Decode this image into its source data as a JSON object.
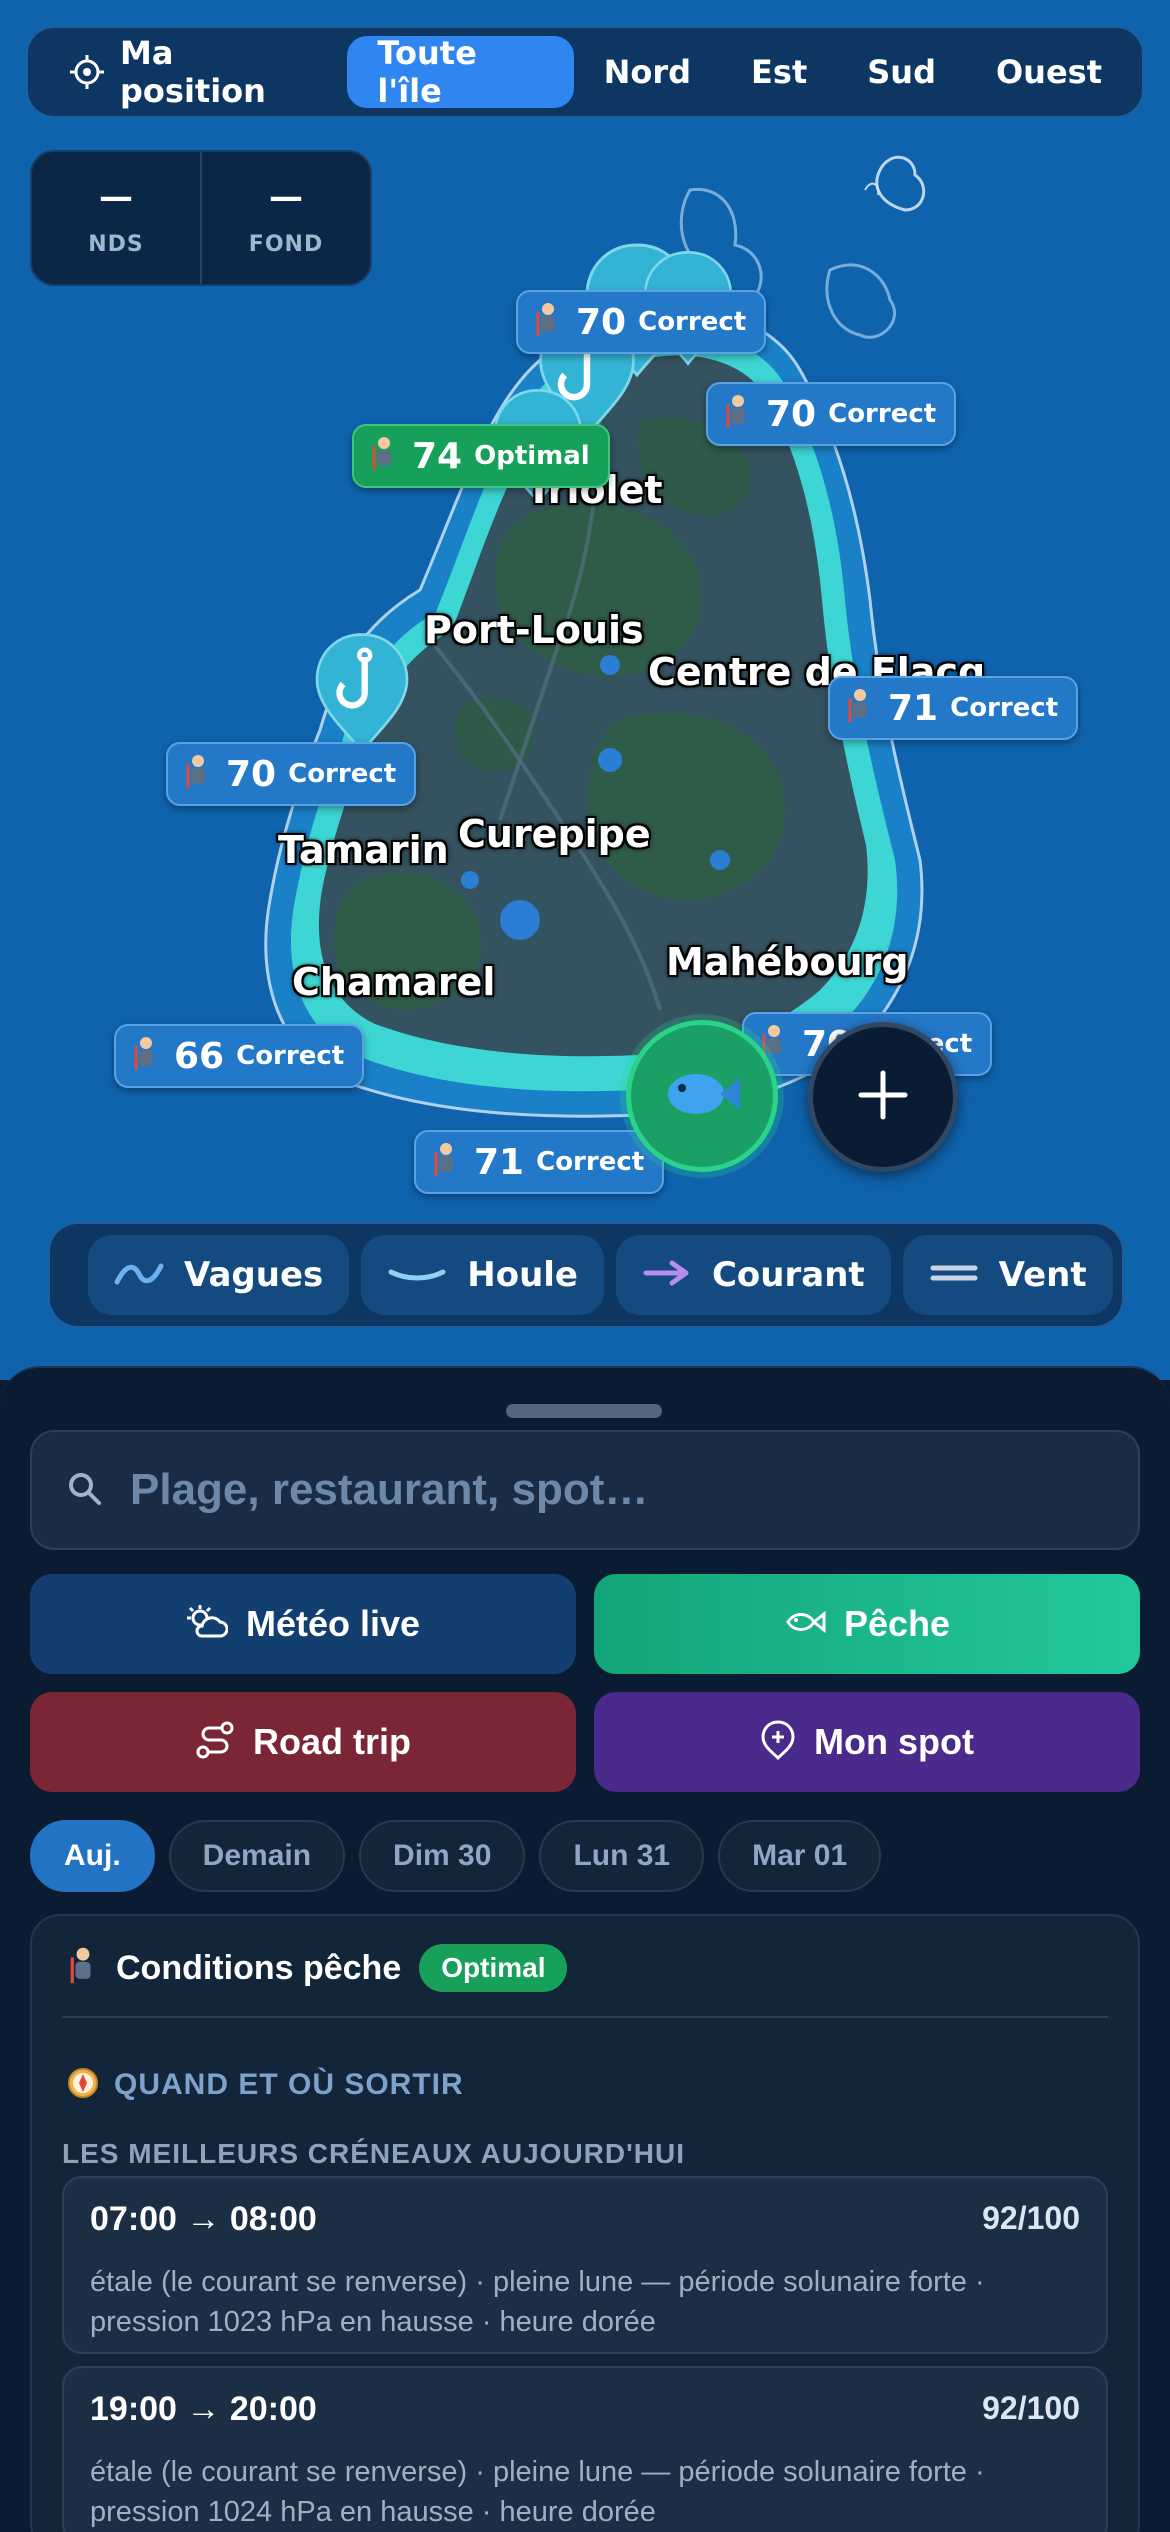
{
  "regions": {
    "my_position": "Ma position",
    "tabs": [
      "Toute l'île",
      "Nord",
      "Est",
      "Sud",
      "Ouest"
    ],
    "active_tab": "Toute l'île"
  },
  "depth": {
    "nds_value": "—",
    "nds_label": "NDS",
    "fond_value": "—",
    "fond_label": "FOND"
  },
  "cities": [
    "Triolet",
    "Port-Louis",
    "Centre de Flacq",
    "Tamarin",
    "Curepipe",
    "Chamarel",
    "Mahébourg"
  ],
  "spots": [
    {
      "score": "70",
      "quality": "Correct"
    },
    {
      "score": "70",
      "quality": "Correct"
    },
    {
      "score": "74",
      "quality": "Optimal"
    },
    {
      "score": "71",
      "quality": "Correct"
    },
    {
      "score": "70",
      "quality": "Correct"
    },
    {
      "score": "66",
      "quality": "Correct"
    },
    {
      "score": "70",
      "quality": "Correct"
    },
    {
      "score": "71",
      "quality": "Correct"
    }
  ],
  "layers": [
    "Vagues",
    "Houle",
    "Courant",
    "Vent"
  ],
  "search": {
    "placeholder": "Plage, restaurant, spot…"
  },
  "actions": {
    "meteo": "Météo live",
    "peche": "Pêche",
    "roadtrip": "Road trip",
    "monspot": "Mon spot"
  },
  "days": [
    "Auj.",
    "Demain",
    "Dim 30",
    "Lun 31",
    "Mar 01"
  ],
  "conditions": {
    "title": "Conditions pêche",
    "status": "Optimal",
    "section": "QUAND ET OÙ SORTIR",
    "subsection": "LES MEILLEURS CRÉNEAUX AUJOURD'HUI",
    "slots": [
      {
        "time": "07:00 → 08:00",
        "score": "92/100",
        "desc": "étale (le courant se renverse) · pleine lune — période solunaire forte · pression 1023 hPa en hausse · heure dorée"
      },
      {
        "time": "19:00 → 20:00",
        "score": "92/100",
        "desc": "étale (le courant se renverse) · pleine lune — période solunaire forte · pression 1024 hPa en hausse · heure dorée"
      }
    ]
  },
  "colors": {
    "ocean": "#0f63ad",
    "land": "#34525f",
    "forest": "#2f5c47",
    "reef": "#3dd6d4",
    "accent": "#2f86f0",
    "optimal": "#16a05a",
    "correct": "#2478c8"
  }
}
